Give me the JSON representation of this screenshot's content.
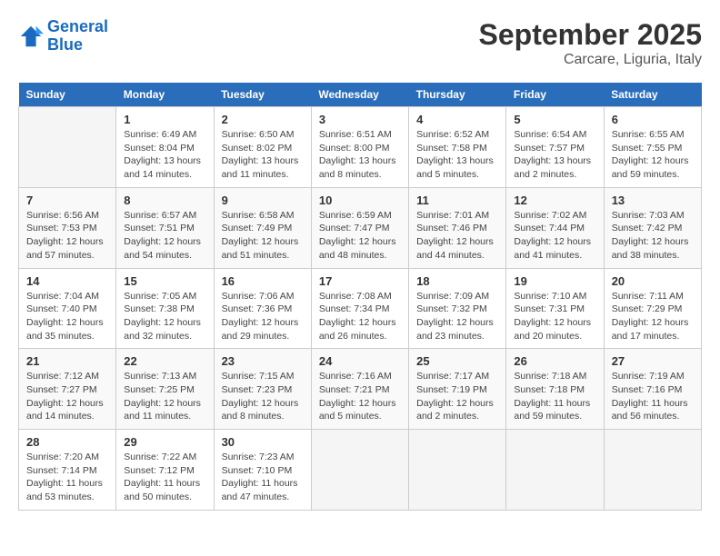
{
  "logo": {
    "general": "General",
    "blue": "Blue"
  },
  "title": "September 2025",
  "subtitle": "Carcare, Liguria, Italy",
  "days_of_week": [
    "Sunday",
    "Monday",
    "Tuesday",
    "Wednesday",
    "Thursday",
    "Friday",
    "Saturday"
  ],
  "weeks": [
    [
      {
        "day": "",
        "info": ""
      },
      {
        "day": "1",
        "info": "Sunrise: 6:49 AM\nSunset: 8:04 PM\nDaylight: 13 hours\nand 14 minutes."
      },
      {
        "day": "2",
        "info": "Sunrise: 6:50 AM\nSunset: 8:02 PM\nDaylight: 13 hours\nand 11 minutes."
      },
      {
        "day": "3",
        "info": "Sunrise: 6:51 AM\nSunset: 8:00 PM\nDaylight: 13 hours\nand 8 minutes."
      },
      {
        "day": "4",
        "info": "Sunrise: 6:52 AM\nSunset: 7:58 PM\nDaylight: 13 hours\nand 5 minutes."
      },
      {
        "day": "5",
        "info": "Sunrise: 6:54 AM\nSunset: 7:57 PM\nDaylight: 13 hours\nand 2 minutes."
      },
      {
        "day": "6",
        "info": "Sunrise: 6:55 AM\nSunset: 7:55 PM\nDaylight: 12 hours\nand 59 minutes."
      }
    ],
    [
      {
        "day": "7",
        "info": "Sunrise: 6:56 AM\nSunset: 7:53 PM\nDaylight: 12 hours\nand 57 minutes."
      },
      {
        "day": "8",
        "info": "Sunrise: 6:57 AM\nSunset: 7:51 PM\nDaylight: 12 hours\nand 54 minutes."
      },
      {
        "day": "9",
        "info": "Sunrise: 6:58 AM\nSunset: 7:49 PM\nDaylight: 12 hours\nand 51 minutes."
      },
      {
        "day": "10",
        "info": "Sunrise: 6:59 AM\nSunset: 7:47 PM\nDaylight: 12 hours\nand 48 minutes."
      },
      {
        "day": "11",
        "info": "Sunrise: 7:01 AM\nSunset: 7:46 PM\nDaylight: 12 hours\nand 44 minutes."
      },
      {
        "day": "12",
        "info": "Sunrise: 7:02 AM\nSunset: 7:44 PM\nDaylight: 12 hours\nand 41 minutes."
      },
      {
        "day": "13",
        "info": "Sunrise: 7:03 AM\nSunset: 7:42 PM\nDaylight: 12 hours\nand 38 minutes."
      }
    ],
    [
      {
        "day": "14",
        "info": "Sunrise: 7:04 AM\nSunset: 7:40 PM\nDaylight: 12 hours\nand 35 minutes."
      },
      {
        "day": "15",
        "info": "Sunrise: 7:05 AM\nSunset: 7:38 PM\nDaylight: 12 hours\nand 32 minutes."
      },
      {
        "day": "16",
        "info": "Sunrise: 7:06 AM\nSunset: 7:36 PM\nDaylight: 12 hours\nand 29 minutes."
      },
      {
        "day": "17",
        "info": "Sunrise: 7:08 AM\nSunset: 7:34 PM\nDaylight: 12 hours\nand 26 minutes."
      },
      {
        "day": "18",
        "info": "Sunrise: 7:09 AM\nSunset: 7:32 PM\nDaylight: 12 hours\nand 23 minutes."
      },
      {
        "day": "19",
        "info": "Sunrise: 7:10 AM\nSunset: 7:31 PM\nDaylight: 12 hours\nand 20 minutes."
      },
      {
        "day": "20",
        "info": "Sunrise: 7:11 AM\nSunset: 7:29 PM\nDaylight: 12 hours\nand 17 minutes."
      }
    ],
    [
      {
        "day": "21",
        "info": "Sunrise: 7:12 AM\nSunset: 7:27 PM\nDaylight: 12 hours\nand 14 minutes."
      },
      {
        "day": "22",
        "info": "Sunrise: 7:13 AM\nSunset: 7:25 PM\nDaylight: 12 hours\nand 11 minutes."
      },
      {
        "day": "23",
        "info": "Sunrise: 7:15 AM\nSunset: 7:23 PM\nDaylight: 12 hours\nand 8 minutes."
      },
      {
        "day": "24",
        "info": "Sunrise: 7:16 AM\nSunset: 7:21 PM\nDaylight: 12 hours\nand 5 minutes."
      },
      {
        "day": "25",
        "info": "Sunrise: 7:17 AM\nSunset: 7:19 PM\nDaylight: 12 hours\nand 2 minutes."
      },
      {
        "day": "26",
        "info": "Sunrise: 7:18 AM\nSunset: 7:18 PM\nDaylight: 11 hours\nand 59 minutes."
      },
      {
        "day": "27",
        "info": "Sunrise: 7:19 AM\nSunset: 7:16 PM\nDaylight: 11 hours\nand 56 minutes."
      }
    ],
    [
      {
        "day": "28",
        "info": "Sunrise: 7:20 AM\nSunset: 7:14 PM\nDaylight: 11 hours\nand 53 minutes."
      },
      {
        "day": "29",
        "info": "Sunrise: 7:22 AM\nSunset: 7:12 PM\nDaylight: 11 hours\nand 50 minutes."
      },
      {
        "day": "30",
        "info": "Sunrise: 7:23 AM\nSunset: 7:10 PM\nDaylight: 11 hours\nand 47 minutes."
      },
      {
        "day": "",
        "info": ""
      },
      {
        "day": "",
        "info": ""
      },
      {
        "day": "",
        "info": ""
      },
      {
        "day": "",
        "info": ""
      }
    ]
  ]
}
